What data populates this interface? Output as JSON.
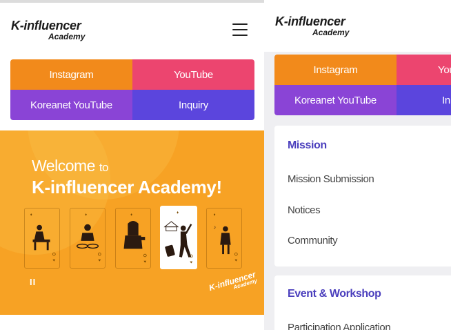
{
  "logo": {
    "line1": "K-influencer",
    "line2": "Academy"
  },
  "menu_buttons": {
    "instagram": "Instagram",
    "youtube": "YouTube",
    "koreanet_youtube": "Koreanet YouTube",
    "inquiry": "Inquiry"
  },
  "right_buttons": {
    "instagram": "Instagram",
    "youtube": "You",
    "koreanet_youtube": "Koreanet YouTube",
    "inquiry": "In"
  },
  "banner": {
    "welcome": "Welcome",
    "to": "to",
    "headline": "K-influencer Academy!",
    "pause": "II",
    "stamp_line1": "K-influencer",
    "stamp_line2": "Academy"
  },
  "menu": {
    "mission": {
      "title": "Mission",
      "items": [
        "Mission Submission",
        "Notices",
        "Community"
      ]
    },
    "event": {
      "title": "Event & Workshop",
      "items": [
        "Participation Application"
      ]
    }
  },
  "icons": {
    "hamburger": "hamburger-menu-icon",
    "pause": "pause-icon"
  },
  "colors": {
    "instagram": "#f28a1b",
    "youtube": "#ec456f",
    "koreanet_youtube": "#8a44d6",
    "inquiry": "#5b45dd",
    "banner": "#f7a224",
    "section_title": "#4b3fbd"
  }
}
